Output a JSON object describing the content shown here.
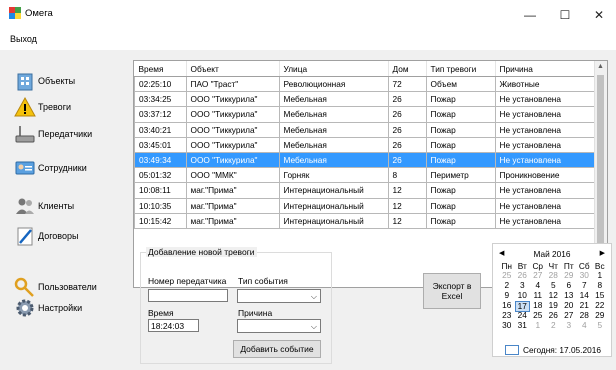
{
  "window": {
    "title": "Омега",
    "minimize": "—",
    "maximize": "☐",
    "close": "✕"
  },
  "menu": {
    "exit": "Выход"
  },
  "sidebar": {
    "items": [
      {
        "label": "Объекты"
      },
      {
        "label": "Тревоги"
      },
      {
        "label": "Передатчики"
      },
      {
        "label": "Сотрудники"
      },
      {
        "label": "Клиенты"
      },
      {
        "label": "Договоры"
      },
      {
        "label": "Пользователи"
      },
      {
        "label": "Настройки"
      }
    ]
  },
  "table": {
    "columns": [
      "Время",
      "Объект",
      "Улица",
      "Дом",
      "Тип тревоги",
      "Причина"
    ],
    "rows": [
      [
        "02:25:10",
        "ПАО \"Траст\"",
        "Революционная",
        "72",
        "Объем",
        "Животные"
      ],
      [
        "03:34:25",
        "ООО \"Тиккурила\"",
        "Мебельная",
        "26",
        "Пожар",
        "Не установлена"
      ],
      [
        "03:37:12",
        "ООО \"Тиккурила\"",
        "Мебельная",
        "26",
        "Пожар",
        "Не установлена"
      ],
      [
        "03:40:21",
        "ООО \"Тиккурила\"",
        "Мебельная",
        "26",
        "Пожар",
        "Не установлена"
      ],
      [
        "03:45:01",
        "ООО \"Тиккурила\"",
        "Мебельная",
        "26",
        "Пожар",
        "Не установлена"
      ],
      [
        "03:49:34",
        "ООО \"Тиккурила\"",
        "Мебельная",
        "26",
        "Пожар",
        "Не установлена"
      ],
      [
        "05:01:32",
        "ООО \"ММК\"",
        "Горняк",
        "8",
        "Периметр",
        "Проникновение"
      ],
      [
        "10:08:11",
        "маг.\"Прима\"",
        "Интернациональный",
        "12",
        "Пожар",
        "Не установлена"
      ],
      [
        "10:10:35",
        "маг.\"Прима\"",
        "Интернациональный",
        "12",
        "Пожар",
        "Не установлена"
      ],
      [
        "10:15:42",
        "маг.\"Прима\"",
        "Интернациональный",
        "12",
        "Пожар",
        "Не установлена"
      ]
    ],
    "selected_row": 5
  },
  "form": {
    "group_title": "Добавление новой тревоги",
    "transmitter_label": "Номер передатчика",
    "transmitter_value": "",
    "event_type_label": "Тип события",
    "event_type_value": "",
    "time_label": "Время",
    "time_value": "18:24:03",
    "reason_label": "Причина",
    "reason_value": "",
    "add_button": "Добавить событие"
  },
  "export_button": "Экспорт в Excel",
  "calendar": {
    "month": "Май 2016",
    "days": [
      "Пн",
      "Вт",
      "Ср",
      "Чт",
      "Пт",
      "Сб",
      "Вс"
    ],
    "weeks": [
      [
        "25",
        "26",
        "27",
        "28",
        "29",
        "30",
        "1"
      ],
      [
        "2",
        "3",
        "4",
        "5",
        "6",
        "7",
        "8"
      ],
      [
        "9",
        "10",
        "11",
        "12",
        "13",
        "14",
        "15"
      ],
      [
        "16",
        "17",
        "18",
        "19",
        "20",
        "21",
        "22"
      ],
      [
        "23",
        "24",
        "25",
        "26",
        "27",
        "28",
        "29"
      ],
      [
        "30",
        "31",
        "1",
        "2",
        "3",
        "4",
        "5"
      ]
    ],
    "today_label": "Сегодня: 17.05.2016",
    "selected": "17"
  }
}
